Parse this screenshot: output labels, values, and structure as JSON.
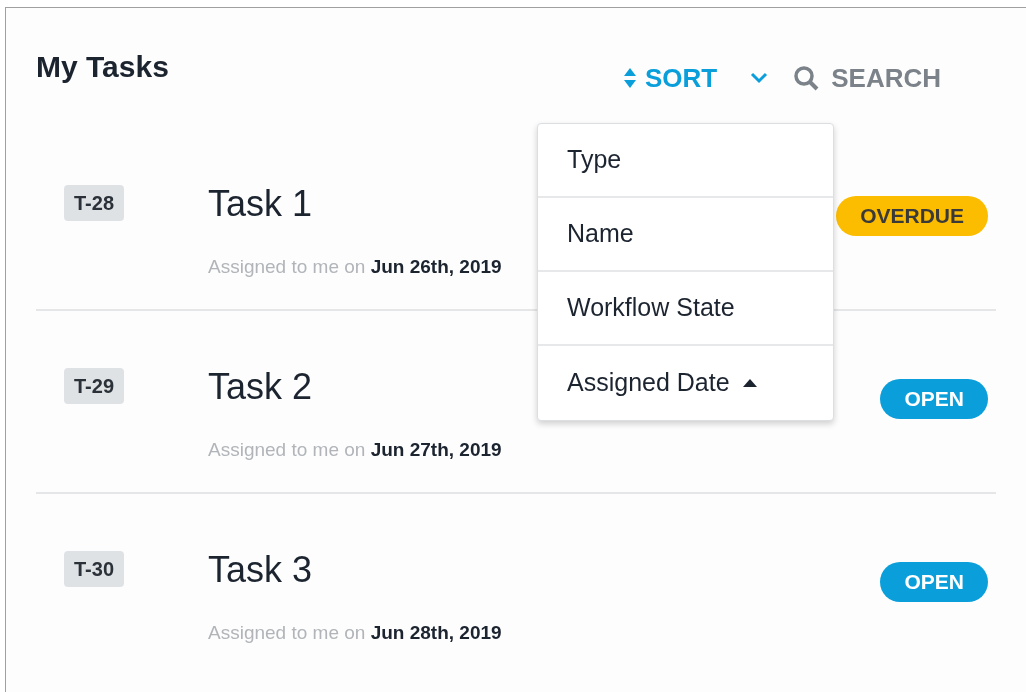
{
  "title": "My Tasks",
  "toolbar": {
    "sort": "SORT",
    "search": "SEARCH"
  },
  "sort_menu": {
    "open": true,
    "options": [
      {
        "label": "Type",
        "selected": false
      },
      {
        "label": "Name",
        "selected": false
      },
      {
        "label": "Workflow State",
        "selected": false
      },
      {
        "label": "Assigned Date",
        "selected": true
      }
    ]
  },
  "tasks": [
    {
      "id": "T-28",
      "name": "Task 1",
      "assigned_prefix": "Assigned to me on",
      "assigned_date": "Jun 26th, 2019",
      "status": "OVERDUE",
      "kind": "overdue"
    },
    {
      "id": "T-29",
      "name": "Task 2",
      "assigned_prefix": "Assigned to me on",
      "assigned_date": "Jun 27th, 2019",
      "status": "OPEN",
      "kind": "open"
    },
    {
      "id": "T-30",
      "name": "Task 3",
      "assigned_prefix": "Assigned to me on",
      "assigned_date": "Jun 28th, 2019",
      "status": "OPEN",
      "kind": "open"
    }
  ]
}
